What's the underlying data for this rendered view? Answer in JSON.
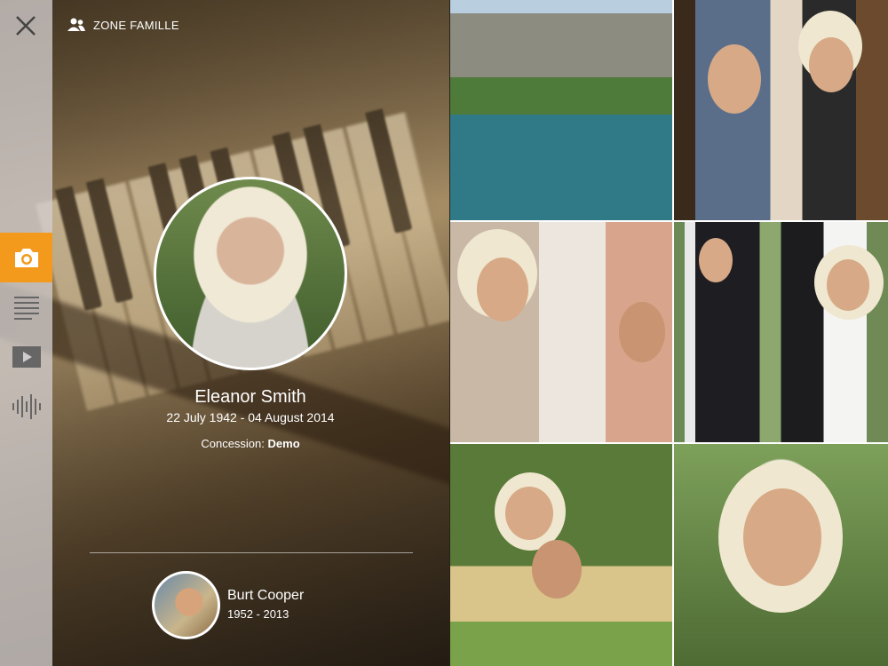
{
  "zone_label": "ZONE FAMILLE",
  "profile": {
    "name": "Eleanor Smith",
    "dates": "22 July 1942 - 04 August 2014",
    "concession_label": "Concession:",
    "concession_value": "Demo"
  },
  "related": {
    "name": "Burt Cooper",
    "dates": "1952 - 2013"
  },
  "nav": {
    "active": "photos",
    "items": [
      "close",
      "photos",
      "text",
      "video",
      "audio"
    ]
  },
  "colors": {
    "accent": "#f39a1c"
  }
}
